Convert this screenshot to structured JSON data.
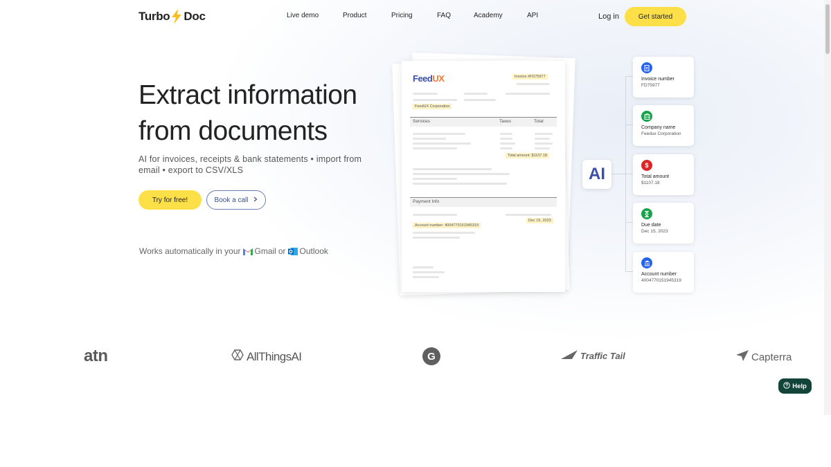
{
  "header": {
    "logo_left": "Turbo",
    "logo_right": "Doc",
    "nav": [
      {
        "label": "Live demo"
      },
      {
        "label": "Product"
      },
      {
        "label": "Pricing"
      },
      {
        "label": "FAQ"
      },
      {
        "label": "Academy"
      },
      {
        "label": "API"
      }
    ],
    "login": "Log in",
    "get_started": "Get started"
  },
  "hero": {
    "title_line1": "Extract information",
    "title_line2": "from documents",
    "subtitle": "AI for invoices, receipts & bank statements • import from email • export to CSV/XLS",
    "try_free": "Try for free!",
    "book_call": "Book a call",
    "works_prefix": "Works automatically in your",
    "gmail": "Gmail",
    "or": "or",
    "outlook": "Outlook"
  },
  "document": {
    "brand_a": "Feed",
    "brand_b": "UX",
    "invoice_tag": "Invoice #FD75977",
    "company_tag": "FeedUX Corporation",
    "col_services": "Services",
    "col_taxes": "Taxes",
    "col_total": "Total",
    "total_amount": "Total amount: $1107.18",
    "payment_info": "Payment Info",
    "due_tag": "Dec 15, 2023",
    "account_tag": "Account number: 4004770151945319"
  },
  "ai_label": "AI",
  "cards": [
    {
      "label": "Invoice number",
      "value": "FD75977",
      "icon": "document-icon",
      "color": "#2563eb"
    },
    {
      "label": "Company name",
      "value": "Feedux Corporation",
      "icon": "building-icon",
      "color": "#16a34a"
    },
    {
      "label": "Total amount",
      "value": "$1107.18",
      "icon": "dollar-icon",
      "color": "#dc2626"
    },
    {
      "label": "Due date",
      "value": "Dec 15, 2023",
      "icon": "hourglass-icon",
      "color": "#16a34a"
    },
    {
      "label": "Account number",
      "value": "4004770151945319",
      "icon": "bank-icon",
      "color": "#2563eb"
    }
  ],
  "brands": [
    "atn",
    "AllThingsAI",
    "G",
    "Traffic Tail",
    "Capterra"
  ],
  "help": "Help",
  "colors": {
    "accent_yellow": "#fde047",
    "brand_blue": "#3b4fa8",
    "help_green": "#13443a"
  }
}
